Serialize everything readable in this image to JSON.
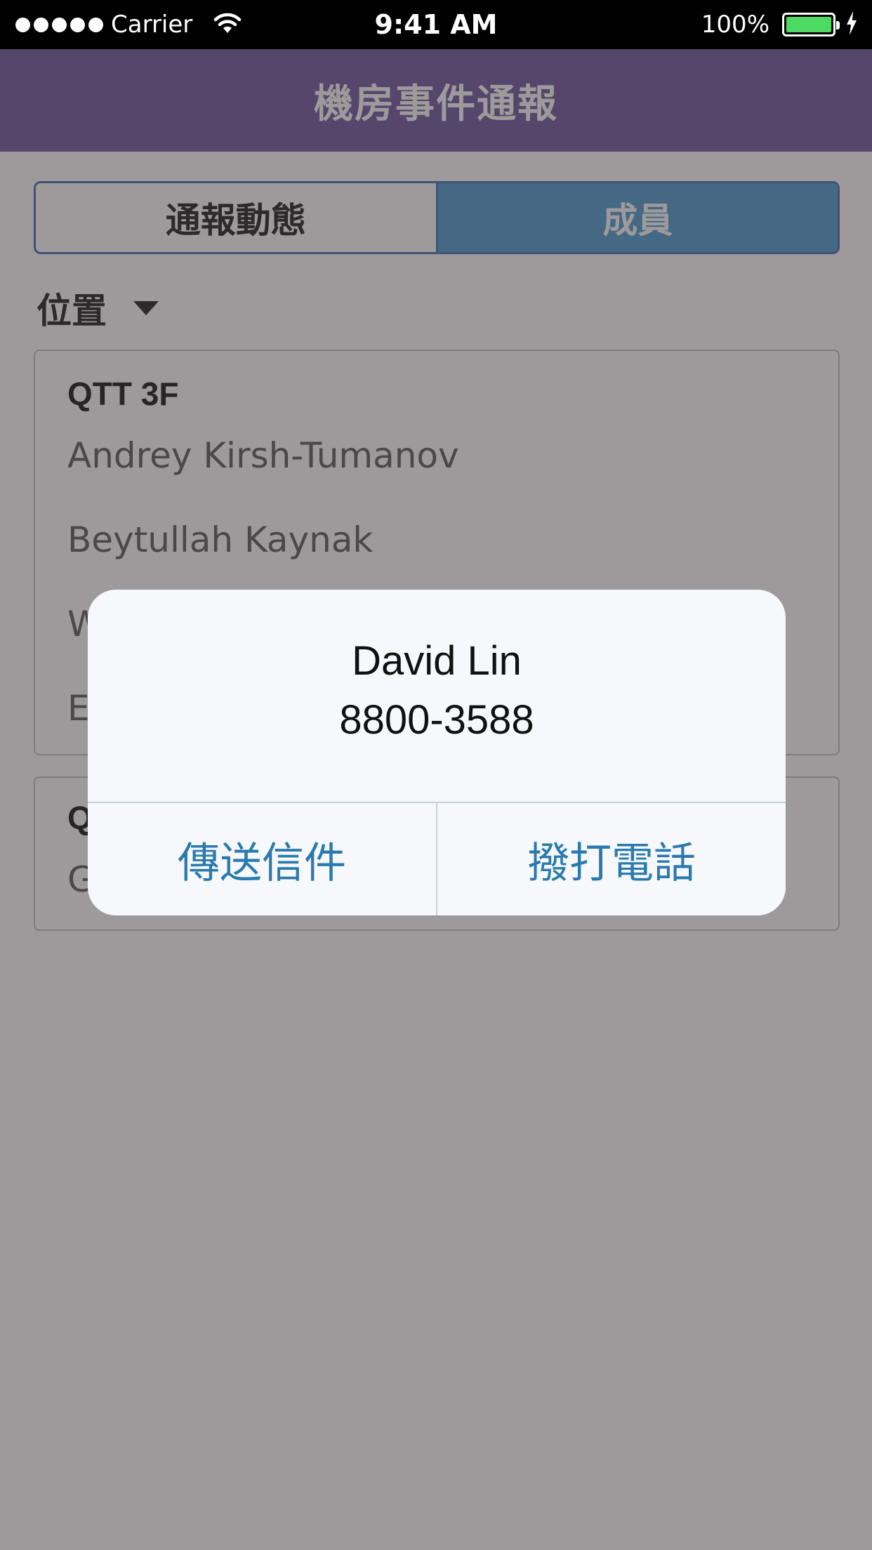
{
  "status_bar": {
    "carrier": "Carrier",
    "time": "9:41 AM",
    "battery_percent": "100%",
    "battery_level": 1.0,
    "battery_color": "#4cd964",
    "icons": [
      "signal-dots-icon",
      "wifi-icon",
      "battery-icon",
      "charging-bolt-icon"
    ]
  },
  "nav": {
    "title": "機房事件通報"
  },
  "segmented": {
    "tabs": [
      {
        "label": "通報動態",
        "selected": false
      },
      {
        "label": "成員",
        "selected": true
      }
    ]
  },
  "filter": {
    "label": "位置",
    "icon": "caret-down-icon"
  },
  "groups": [
    {
      "title": "QTT 3F",
      "members": [
        "Andrey Kirsh-Tumanov",
        "Beytullah Kaynak",
        "W",
        "E"
      ]
    },
    {
      "title": "Q",
      "members": [
        "G"
      ]
    }
  ],
  "alert": {
    "name": "David Lin",
    "phone": "8800-3588",
    "actions": [
      {
        "label": "傳送信件"
      },
      {
        "label": "撥打電話"
      }
    ]
  },
  "colors": {
    "nav_bar": "#7d66a9",
    "segment_active": "#5ea7d6",
    "segment_border": "#4f80ba",
    "alert_button_text": "#2a7aae"
  }
}
